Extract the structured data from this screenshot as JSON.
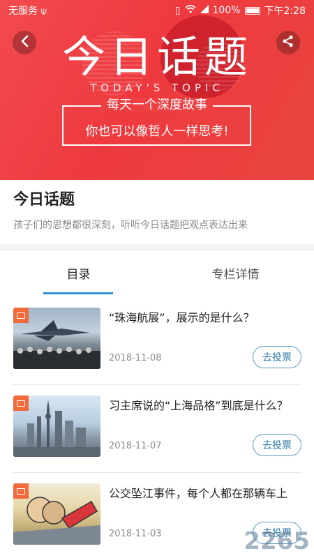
{
  "status_bar": {
    "carrier": "无服务",
    "battery": "100%",
    "time": "下午2:28"
  },
  "banner": {
    "title": "今日话题",
    "subtitle_en": "TODAY'S TOPIC",
    "slogan_line1": "每天一个深度故事",
    "slogan_line2": "你也可以像哲人一样思考!",
    "icons": {
      "back": "chevron-left-icon",
      "share": "share-icon"
    },
    "colors": {
      "accent": "#ee3f43"
    }
  },
  "intro": {
    "title": "今日话题",
    "description": "孩子们的思想都很深刻，听听今日话题把观点表达出来"
  },
  "tabs": [
    {
      "label": "目录",
      "active": true
    },
    {
      "label": "专栏详情",
      "active": false
    }
  ],
  "topics": [
    {
      "title": "“珠海航展”，展示的是什么？",
      "date": "2018-11-08",
      "action": "去投票"
    },
    {
      "title": "习主席说的“上海品格”到底是什么？",
      "date": "2018-11-07",
      "action": "去投票"
    },
    {
      "title": "公交坠江事件，每个人都在那辆车上",
      "date": "2018-11-03",
      "action": "去投票"
    }
  ],
  "watermark": "2265"
}
